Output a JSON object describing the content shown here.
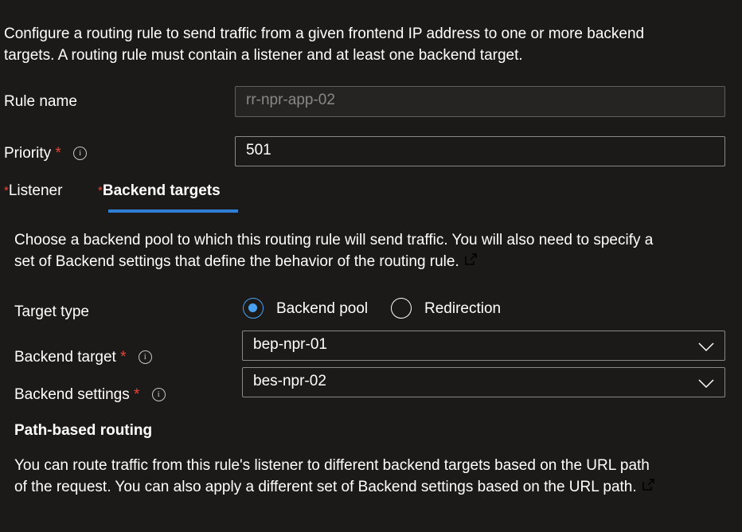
{
  "intro": {
    "line1": "Configure a routing rule to send traffic from a given frontend IP address to one or more backend",
    "line2": "targets. A routing rule must contain a listener and at least one backend target."
  },
  "rule_name": {
    "label": "Rule name",
    "value": "rr-npr-app-02"
  },
  "priority": {
    "label": "Priority",
    "required": "*",
    "value": "501"
  },
  "tabs": [
    {
      "label": "Listener",
      "required": "*",
      "active": false
    },
    {
      "label": "Backend targets",
      "required": "*",
      "active": true
    }
  ],
  "backend": {
    "desc_line1": "Choose a backend pool to which this routing rule will send traffic. You will also need to specify a",
    "desc_line2": "set of Backend settings that define the behavior of the routing rule.",
    "target_type": {
      "label": "Target type",
      "options": [
        {
          "label": "Backend pool",
          "selected": true
        },
        {
          "label": "Redirection",
          "selected": false
        }
      ]
    },
    "backend_target": {
      "label": "Backend target",
      "required": "*",
      "value": "bep-npr-01"
    },
    "backend_settings": {
      "label": "Backend settings",
      "required": "*",
      "value": "bes-npr-02"
    }
  },
  "path_routing": {
    "heading": "Path-based routing",
    "line1": "You can route traffic from this rule's listener to different backend targets based on the URL path",
    "line2": "of the request. You can also apply a different set of Backend settings based on the URL path."
  },
  "colors": {
    "accent": "#2f7fd6",
    "required": "#e8443a",
    "radio": "#4aa0f0"
  }
}
